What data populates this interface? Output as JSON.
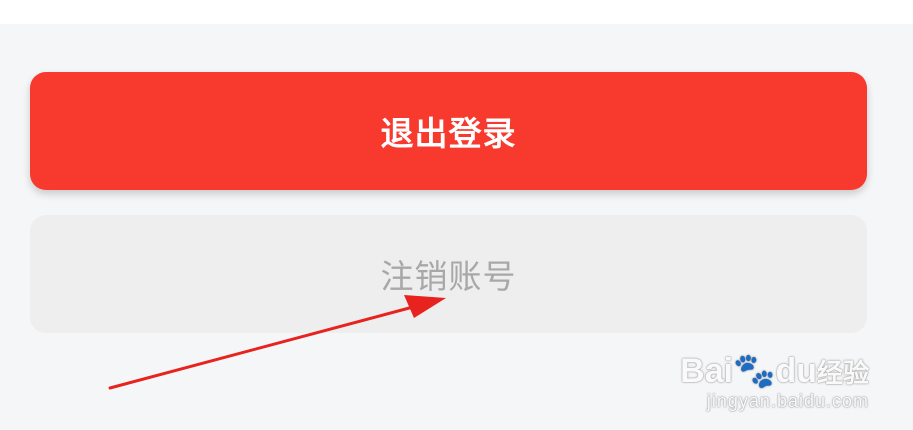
{
  "buttons": {
    "logout_label": "退出登录",
    "delete_account_label": "注销账号"
  },
  "colors": {
    "logout_bg": "#f8392d",
    "delete_bg": "#eeeeee",
    "annotation_arrow": "#e8231f"
  },
  "watermark": {
    "brand_prefix": "Bai",
    "brand_suffix": "du",
    "brand_sub": "经验",
    "url": "jingyan.baidu.com"
  }
}
